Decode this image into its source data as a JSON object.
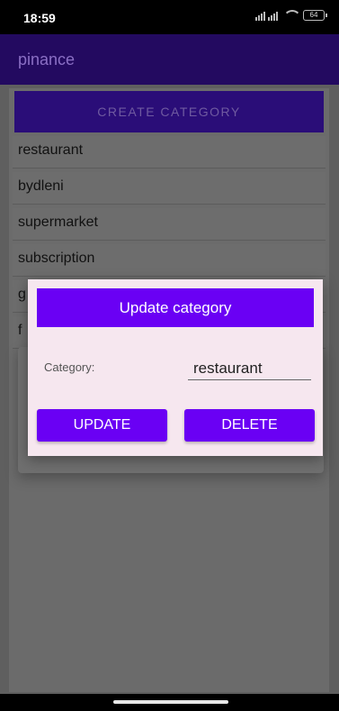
{
  "status_bar": {
    "time": "18:59",
    "battery": "64",
    "icons": [
      "signal-icon",
      "wifi-icon",
      "battery-icon"
    ]
  },
  "app_bar": {
    "title": "pinance"
  },
  "main": {
    "create_label": "CREATE CATEGORY",
    "categories": [
      {
        "label": "restaurant"
      },
      {
        "label": "bydleni"
      },
      {
        "label": "supermarket"
      },
      {
        "label": "subscription"
      },
      {
        "label": "g"
      },
      {
        "label": "f"
      }
    ]
  },
  "dialog": {
    "title": "Update category",
    "field_label": "Category:",
    "field_value": "restaurant",
    "update_label": "UPDATE",
    "delete_label": "DELETE"
  },
  "colors": {
    "accent": "#6a00f4",
    "app_bar": "#230a60",
    "dialog_bg": "#f6e7ef"
  }
}
